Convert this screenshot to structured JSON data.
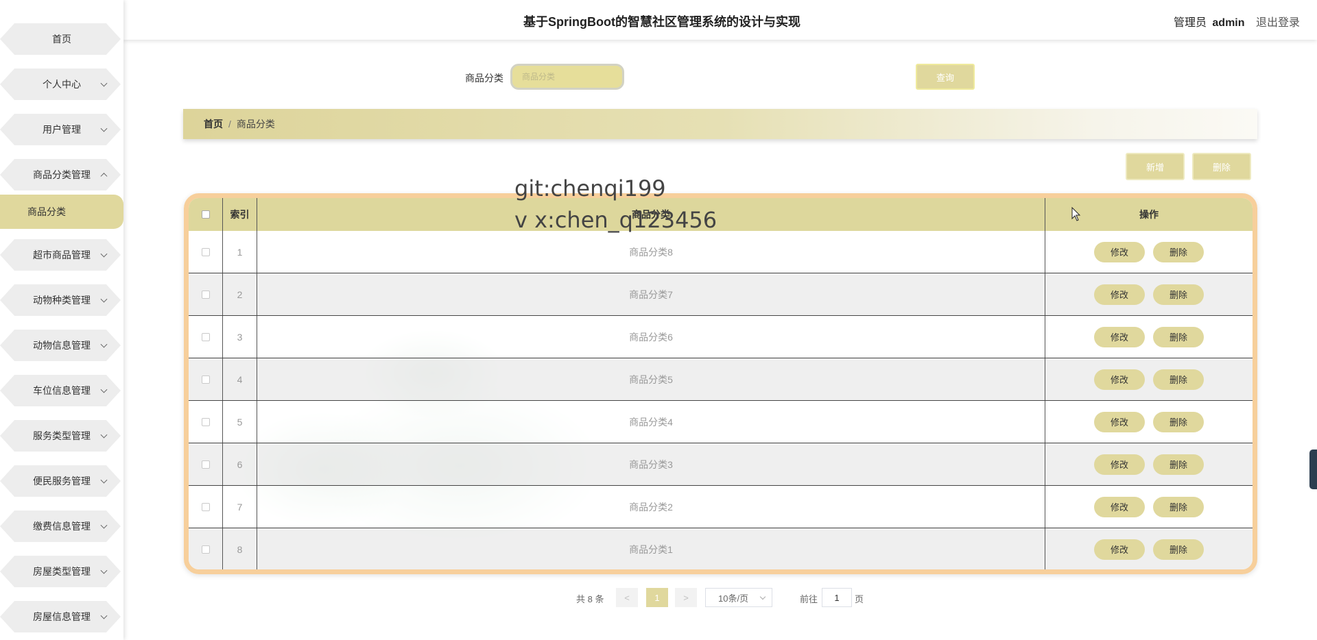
{
  "app": {
    "title": "基于SpringBoot的智慧社区管理系统的设计与实现",
    "user_role": "管理员",
    "user_name": "admin",
    "logout_label": "退出登录"
  },
  "sidebar": {
    "items": [
      {
        "label": "首页",
        "expandable": false
      },
      {
        "label": "个人中心",
        "expandable": true
      },
      {
        "label": "用户管理",
        "expandable": true
      },
      {
        "label": "商品分类管理",
        "expandable": true,
        "expanded": true
      },
      {
        "label": "超市商品管理",
        "expandable": true
      },
      {
        "label": "动物种类管理",
        "expandable": true
      },
      {
        "label": "动物信息管理",
        "expandable": true
      },
      {
        "label": "车位信息管理",
        "expandable": true
      },
      {
        "label": "服务类型管理",
        "expandable": true
      },
      {
        "label": "便民服务管理",
        "expandable": true
      },
      {
        "label": "缴费信息管理",
        "expandable": true
      },
      {
        "label": "房屋类型管理",
        "expandable": true
      },
      {
        "label": "房屋信息管理",
        "expandable": true
      }
    ],
    "active_subitem": "商品分类"
  },
  "search": {
    "label": "商品分类",
    "placeholder": "商品分类",
    "value": "",
    "button_label": "查询"
  },
  "breadcrumb": {
    "home": "首页",
    "separator": "/",
    "current": "商品分类"
  },
  "actions": {
    "add_label": "新增",
    "delete_label": "删除"
  },
  "table": {
    "headers": {
      "index": "索引",
      "name": "商品分类",
      "operations": "操作"
    },
    "edit_label": "修改",
    "delete_label": "删除",
    "rows": [
      {
        "index": "1",
        "name": "商品分类8"
      },
      {
        "index": "2",
        "name": "商品分类7"
      },
      {
        "index": "3",
        "name": "商品分类6"
      },
      {
        "index": "4",
        "name": "商品分类5"
      },
      {
        "index": "5",
        "name": "商品分类4"
      },
      {
        "index": "6",
        "name": "商品分类3"
      },
      {
        "index": "7",
        "name": "商品分类2"
      },
      {
        "index": "8",
        "name": "商品分类1"
      }
    ]
  },
  "pagination": {
    "total_text": "共 8 条",
    "prev": "<",
    "current_page": "1",
    "next": ">",
    "page_size": "10条/页",
    "goto_label": "前往",
    "goto_value": "1",
    "page_unit": "页"
  },
  "watermark": {
    "line1": "git:chenqi199",
    "line2": "v x:chen_q123456"
  },
  "colors": {
    "accent": "#e0d89d",
    "table_border": "#f7cf9b",
    "header_bg": "#ddd79c"
  }
}
